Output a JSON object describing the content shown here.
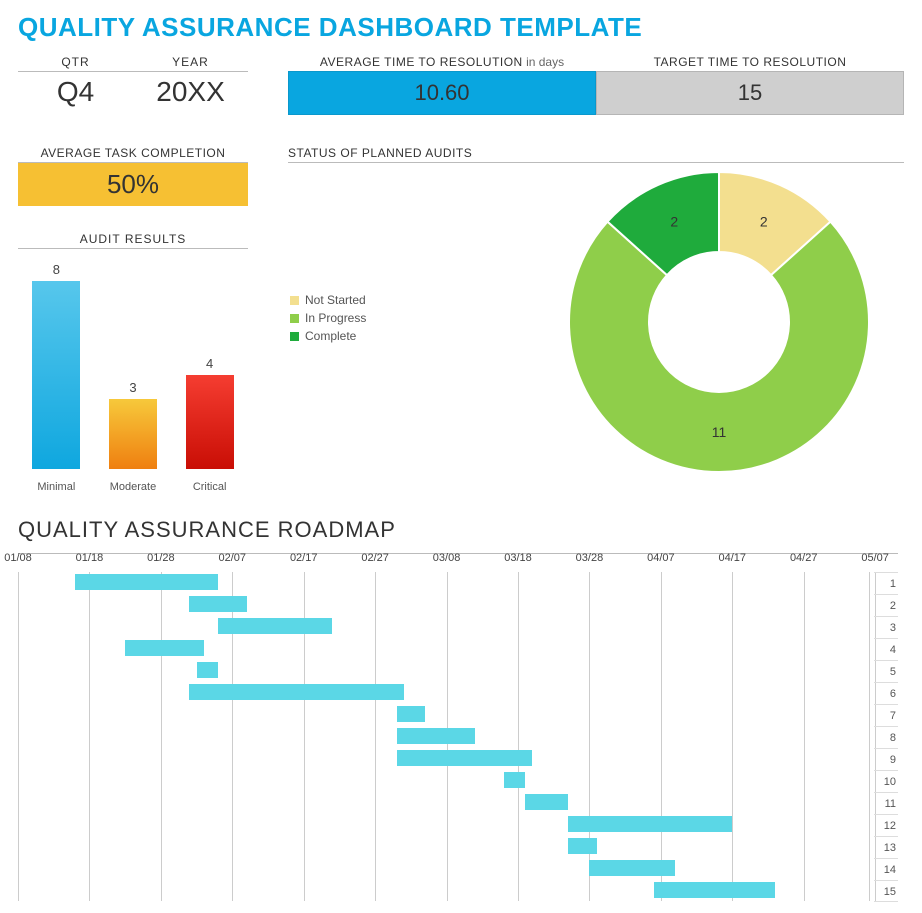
{
  "title": "QUALITY ASSURANCE DASHBOARD TEMPLATE",
  "qtr_label": "QTR",
  "year_label": "YEAR",
  "qtr": "Q4",
  "year": "20XX",
  "avg_time_label": "AVERAGE TIME TO RESOLUTION",
  "avg_time_suffix": " in days",
  "avg_time_value": "10.60",
  "target_time_label": "TARGET TIME TO RESOLUTION",
  "target_time_value": "15",
  "atc_label": "AVERAGE TASK COMPLETION",
  "atc_value": "50%",
  "audit_results_label": "AUDIT RESULTS",
  "spa_label": "STATUS OF PLANNED AUDITS",
  "legend": {
    "ns": "Not Started",
    "ip": "In Progress",
    "cp": "Complete"
  },
  "roadmap_title": "QUALITY ASSURANCE ROADMAP",
  "chart_data": [
    {
      "type": "bar",
      "title": "AUDIT RESULTS",
      "categories": [
        "Minimal",
        "Moderate",
        "Critical"
      ],
      "values": [
        8,
        3,
        4
      ],
      "ylim": [
        0,
        8
      ]
    },
    {
      "type": "pie",
      "title": "STATUS OF PLANNED AUDITS",
      "series": [
        {
          "name": "Not Started",
          "value": 2,
          "color": "#f3df8f"
        },
        {
          "name": "In Progress",
          "value": 11,
          "color": "#8fce4a"
        },
        {
          "name": "Complete",
          "value": 2,
          "color": "#1fab3c"
        }
      ]
    },
    {
      "type": "gantt",
      "title": "QUALITY ASSURANCE ROADMAP",
      "x_ticks": [
        "01/08",
        "01/18",
        "01/28",
        "02/07",
        "02/17",
        "02/27",
        "03/08",
        "03/18",
        "03/28",
        "04/07",
        "04/17",
        "04/27",
        "05/07"
      ],
      "x_domain_days": [
        0,
        119
      ],
      "rows": [
        1,
        2,
        3,
        4,
        5,
        6,
        7,
        8,
        9,
        10,
        11,
        12,
        13,
        14,
        15
      ],
      "tasks": [
        {
          "row": 1,
          "start": 8,
          "end": 28
        },
        {
          "row": 2,
          "start": 24,
          "end": 32
        },
        {
          "row": 3,
          "start": 28,
          "end": 44
        },
        {
          "row": 4,
          "start": 15,
          "end": 26
        },
        {
          "row": 5,
          "start": 25,
          "end": 28
        },
        {
          "row": 6,
          "start": 24,
          "end": 54
        },
        {
          "row": 7,
          "start": 53,
          "end": 57
        },
        {
          "row": 8,
          "start": 53,
          "end": 64
        },
        {
          "row": 9,
          "start": 53,
          "end": 72
        },
        {
          "row": 10,
          "start": 68,
          "end": 71
        },
        {
          "row": 11,
          "start": 71,
          "end": 77
        },
        {
          "row": 12,
          "start": 77,
          "end": 100
        },
        {
          "row": 13,
          "start": 77,
          "end": 81
        },
        {
          "row": 14,
          "start": 80,
          "end": 92
        },
        {
          "row": 15,
          "start": 89,
          "end": 106
        }
      ]
    }
  ]
}
